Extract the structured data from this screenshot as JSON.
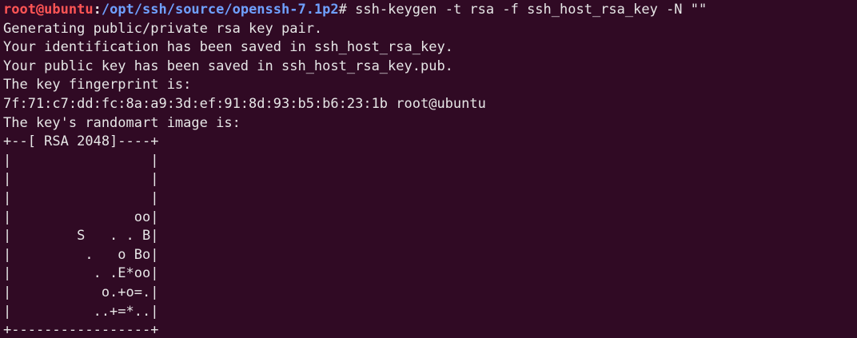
{
  "terminal": {
    "prompt": {
      "user_host": "root@ubuntu",
      "separator": ":",
      "path": "/opt/ssh/source/openssh-7.1p2",
      "symbol": "# ",
      "command": "ssh-keygen -t rsa -f ssh_host_rsa_key -N \"\""
    },
    "output": [
      "Generating public/private rsa key pair.",
      "Your identification has been saved in ssh_host_rsa_key.",
      "Your public key has been saved in ssh_host_rsa_key.pub.",
      "The key fingerprint is:",
      "7f:71:c7:dd:fc:8a:a9:3d:ef:91:8d:93:b5:b6:23:1b root@ubuntu",
      "The key's randomart image is:",
      "+--[ RSA 2048]----+",
      "|                 |",
      "|                 |",
      "|                 |",
      "|               oo|",
      "|        S   . . B|",
      "|         .   o Bo|",
      "|          . .E*oo|",
      "|           o.+o=.|",
      "|          ..+=*..|",
      "+-----------------+"
    ],
    "colors": {
      "background": "#300a24",
      "text": "#e6e6e6",
      "user_host": "#ff5555",
      "path": "#6fa0ff"
    }
  }
}
